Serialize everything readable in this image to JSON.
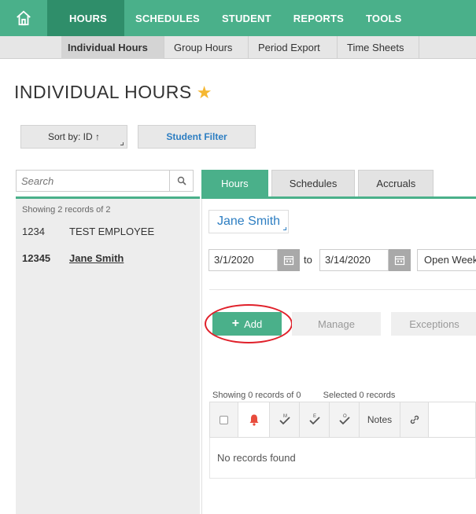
{
  "nav": {
    "items": [
      {
        "label": "HOURS",
        "active": true
      },
      {
        "label": "SCHEDULES",
        "active": false
      },
      {
        "label": "STUDENT",
        "active": false
      },
      {
        "label": "REPORTS",
        "active": false
      },
      {
        "label": "TOOLS",
        "active": false
      }
    ],
    "home_icon": "home-icon"
  },
  "subnav": {
    "items": [
      {
        "label": "Individual Hours",
        "active": true
      },
      {
        "label": "Group Hours",
        "active": false
      },
      {
        "label": "Period Export",
        "active": false
      },
      {
        "label": "Time Sheets",
        "active": false
      }
    ]
  },
  "page": {
    "title": "INDIVIDUAL HOURS",
    "star_icon": "star-icon",
    "star_color": "#f5b731"
  },
  "controls": {
    "sort_label": "Sort by: ID ↑",
    "filter_label": "Student Filter"
  },
  "sidebar": {
    "search_placeholder": "Search",
    "search_icon": "search-icon",
    "showing_text": "Showing 2 records of 2",
    "records": [
      {
        "id": "1234",
        "name": "TEST EMPLOYEE",
        "selected": false
      },
      {
        "id": "12345",
        "name": "Jane Smith",
        "selected": true
      }
    ]
  },
  "tabs": [
    {
      "label": "Hours",
      "active": true
    },
    {
      "label": "Schedules",
      "active": false
    },
    {
      "label": "Accruals",
      "active": false
    }
  ],
  "detail": {
    "person_name": "Jane Smith",
    "start_date": "3/1/2020",
    "to_label": "to",
    "end_date": "3/14/2020",
    "period_select": "Open Weeks",
    "buttons": {
      "add": "Add",
      "manage": "Manage",
      "exceptions": "Exceptions"
    },
    "grid": {
      "showing_text": "Showing 0 records of 0",
      "selected_text": "Selected 0 records",
      "notes_header": "Notes",
      "empty_text": "No records found",
      "col_icons": [
        "alarm-bell-icon",
        "m-check-icon",
        "e-check-icon",
        "o-check-icon",
        "link-icon"
      ]
    }
  },
  "colors": {
    "brand_green": "#4ab08a",
    "nav_active": "#2f8e6a",
    "link_blue": "#2d7ec2",
    "alert_red": "#e84c3d",
    "highlight_circle": "#e0202a"
  }
}
